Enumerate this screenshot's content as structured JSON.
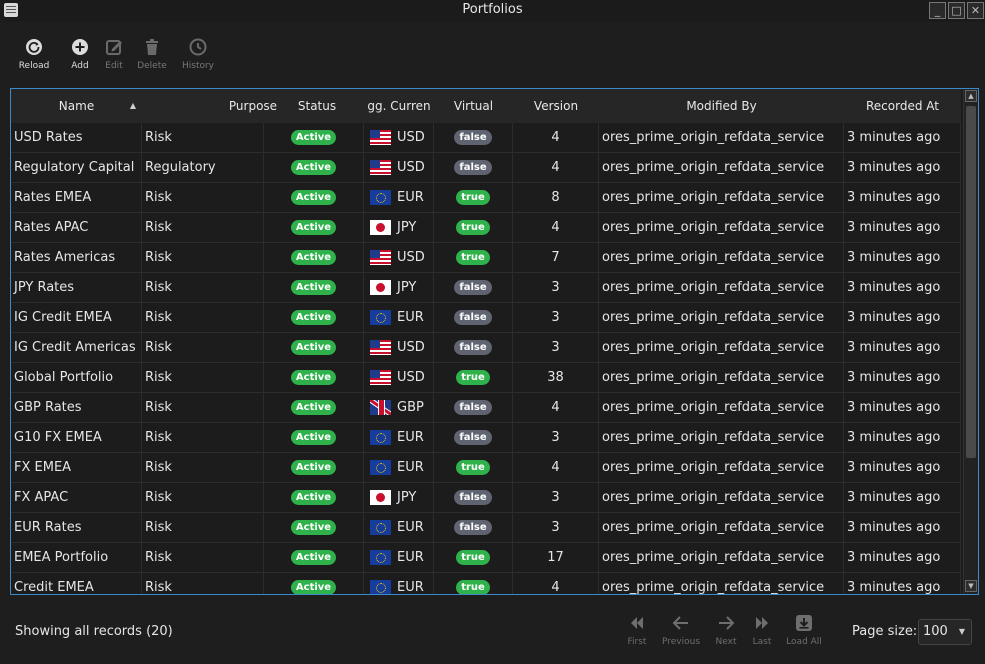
{
  "window": {
    "title": "Portfolios"
  },
  "toolbar": {
    "reload_label": "Reload",
    "add_label": "Add",
    "edit_label": "Edit",
    "delete_label": "Delete",
    "history_label": "History"
  },
  "table": {
    "columns": [
      "Name",
      "Purpose",
      "Status",
      "gg. Curren",
      "Virtual",
      "Version",
      "Modified By",
      "Recorded At"
    ],
    "sort": {
      "column": "Name",
      "direction": "ascending"
    },
    "rows": [
      {
        "name": "USD Rates",
        "purpose": "Risk",
        "status": "Active",
        "currency": "USD",
        "virtual": "false",
        "version": "4",
        "modified_by": "ores_prime_origin_refdata_service",
        "recorded_at": "3 minutes ago"
      },
      {
        "name": "Regulatory Capital",
        "purpose": "Regulatory",
        "status": "Active",
        "currency": "USD",
        "virtual": "false",
        "version": "4",
        "modified_by": "ores_prime_origin_refdata_service",
        "recorded_at": "3 minutes ago"
      },
      {
        "name": "Rates EMEA",
        "purpose": "Risk",
        "status": "Active",
        "currency": "EUR",
        "virtual": "true",
        "version": "8",
        "modified_by": "ores_prime_origin_refdata_service",
        "recorded_at": "3 minutes ago"
      },
      {
        "name": "Rates APAC",
        "purpose": "Risk",
        "status": "Active",
        "currency": "JPY",
        "virtual": "true",
        "version": "4",
        "modified_by": "ores_prime_origin_refdata_service",
        "recorded_at": "3 minutes ago"
      },
      {
        "name": "Rates Americas",
        "purpose": "Risk",
        "status": "Active",
        "currency": "USD",
        "virtual": "true",
        "version": "7",
        "modified_by": "ores_prime_origin_refdata_service",
        "recorded_at": "3 minutes ago"
      },
      {
        "name": "JPY Rates",
        "purpose": "Risk",
        "status": "Active",
        "currency": "JPY",
        "virtual": "false",
        "version": "3",
        "modified_by": "ores_prime_origin_refdata_service",
        "recorded_at": "3 minutes ago"
      },
      {
        "name": "IG Credit EMEA",
        "purpose": "Risk",
        "status": "Active",
        "currency": "EUR",
        "virtual": "false",
        "version": "3",
        "modified_by": "ores_prime_origin_refdata_service",
        "recorded_at": "3 minutes ago"
      },
      {
        "name": "IG Credit Americas",
        "purpose": "Risk",
        "status": "Active",
        "currency": "USD",
        "virtual": "false",
        "version": "3",
        "modified_by": "ores_prime_origin_refdata_service",
        "recorded_at": "3 minutes ago"
      },
      {
        "name": "Global Portfolio",
        "purpose": "Risk",
        "status": "Active",
        "currency": "USD",
        "virtual": "true",
        "version": "38",
        "modified_by": "ores_prime_origin_refdata_service",
        "recorded_at": "3 minutes ago"
      },
      {
        "name": "GBP Rates",
        "purpose": "Risk",
        "status": "Active",
        "currency": "GBP",
        "virtual": "false",
        "version": "4",
        "modified_by": "ores_prime_origin_refdata_service",
        "recorded_at": "3 minutes ago"
      },
      {
        "name": "G10 FX EMEA",
        "purpose": "Risk",
        "status": "Active",
        "currency": "EUR",
        "virtual": "false",
        "version": "3",
        "modified_by": "ores_prime_origin_refdata_service",
        "recorded_at": "3 minutes ago"
      },
      {
        "name": "FX EMEA",
        "purpose": "Risk",
        "status": "Active",
        "currency": "EUR",
        "virtual": "true",
        "version": "4",
        "modified_by": "ores_prime_origin_refdata_service",
        "recorded_at": "3 minutes ago"
      },
      {
        "name": "FX APAC",
        "purpose": "Risk",
        "status": "Active",
        "currency": "JPY",
        "virtual": "false",
        "version": "3",
        "modified_by": "ores_prime_origin_refdata_service",
        "recorded_at": "3 minutes ago"
      },
      {
        "name": "EUR Rates",
        "purpose": "Risk",
        "status": "Active",
        "currency": "EUR",
        "virtual": "false",
        "version": "3",
        "modified_by": "ores_prime_origin_refdata_service",
        "recorded_at": "3 minutes ago"
      },
      {
        "name": "EMEA Portfolio",
        "purpose": "Risk",
        "status": "Active",
        "currency": "EUR",
        "virtual": "true",
        "version": "17",
        "modified_by": "ores_prime_origin_refdata_service",
        "recorded_at": "3 minutes ago"
      },
      {
        "name": "Credit EMEA",
        "purpose": "Risk",
        "status": "Active",
        "currency": "EUR",
        "virtual": "true",
        "version": "4",
        "modified_by": "ores_prime_origin_refdata_service",
        "recorded_at": "3 minutes ago"
      }
    ]
  },
  "footer": {
    "status_text": "Showing all records (20)",
    "first_label": "First",
    "previous_label": "Previous",
    "next_label": "Next",
    "last_label": "Last",
    "load_all_label": "Load All",
    "page_size_label": "Page size:",
    "page_size_value": "100"
  },
  "icons": {
    "reload": "reload-icon",
    "add": "add-icon",
    "edit": "edit-icon",
    "delete": "delete-icon",
    "history": "history-icon",
    "first": "first-page-icon",
    "previous": "previous-page-icon",
    "next": "next-page-icon",
    "last": "last-page-icon",
    "load_all": "download-icon"
  },
  "colors": {
    "accent_border": "#3d8ac8",
    "active_badge": "#2fb24b",
    "false_badge": "#5f6470",
    "background": "#1e1e1e"
  }
}
